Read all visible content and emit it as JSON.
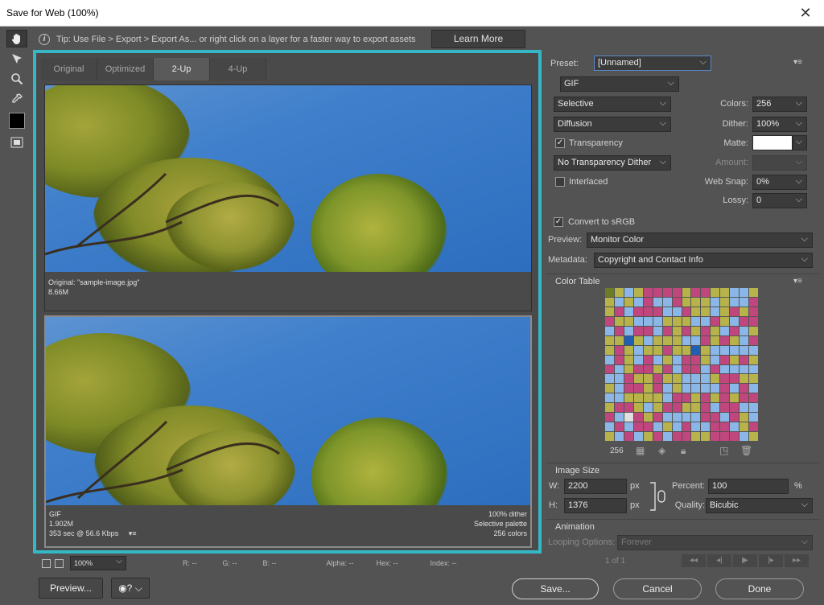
{
  "window": {
    "title": "Save for Web (100%)",
    "close_glyph": "✕"
  },
  "tip": {
    "text": "Tip: Use File > Export > Export As...  or right click on a layer for a faster way to export assets",
    "learn_more": "Learn More"
  },
  "tabs": [
    {
      "label": "Original"
    },
    {
      "label": "Optimized"
    },
    {
      "label": "2-Up"
    },
    {
      "label": "4-Up"
    }
  ],
  "selected_tab": "2-Up",
  "original_pane": {
    "line1": "Original: \"sample-image.jpg\"",
    "line2": "8.66M"
  },
  "optimized_pane": {
    "left": [
      "GIF",
      "1.902M",
      "353 sec @ 56.6 Kbps"
    ],
    "right": [
      "100% dither",
      "Selective palette",
      "256 colors"
    ]
  },
  "status": {
    "zoom": "100%",
    "r": "R: --",
    "g": "G: --",
    "b": "B: --",
    "alpha": "Alpha: --",
    "hex": "Hex: --",
    "index": "Index: --"
  },
  "settings": {
    "preset_label": "Preset:",
    "preset_value": "[Unnamed]",
    "format": "GIF",
    "reduction": "Selective",
    "dither_algo": "Diffusion",
    "colors_label": "Colors:",
    "colors_value": "256",
    "dither_label": "Dither:",
    "dither_value": "100%",
    "transparency_label": "Transparency",
    "transparency_checked": true,
    "matte_label": "Matte:",
    "amount_label": "Amount:",
    "trans_dither": "No Transparency Dither",
    "interlaced_label": "Interlaced",
    "interlaced_checked": false,
    "websnap_label": "Web Snap:",
    "websnap_value": "0%",
    "lossy_label": "Lossy:",
    "lossy_value": "0",
    "srgb_label": "Convert to sRGB",
    "srgb_checked": true,
    "preview_label": "Preview:",
    "preview_value": "Monitor Color",
    "metadata_label": "Metadata:",
    "metadata_value": "Copyright and Contact Info"
  },
  "color_table": {
    "title": "Color Table",
    "count": "256"
  },
  "image_size": {
    "title": "Image Size",
    "w_label": "W:",
    "w_value": "2200",
    "h_label": "H:",
    "h_value": "1376",
    "unit": "px",
    "percent_label": "Percent:",
    "percent_value": "100",
    "percent_unit": "%",
    "quality_label": "Quality:",
    "quality_value": "Bicubic"
  },
  "animation": {
    "title": "Animation",
    "looping_label": "Looping Options:",
    "looping_value": "Forever",
    "frame": "1 of 1"
  },
  "buttons": {
    "preview": "Preview...",
    "save": "Save...",
    "cancel": "Cancel",
    "done": "Done"
  }
}
